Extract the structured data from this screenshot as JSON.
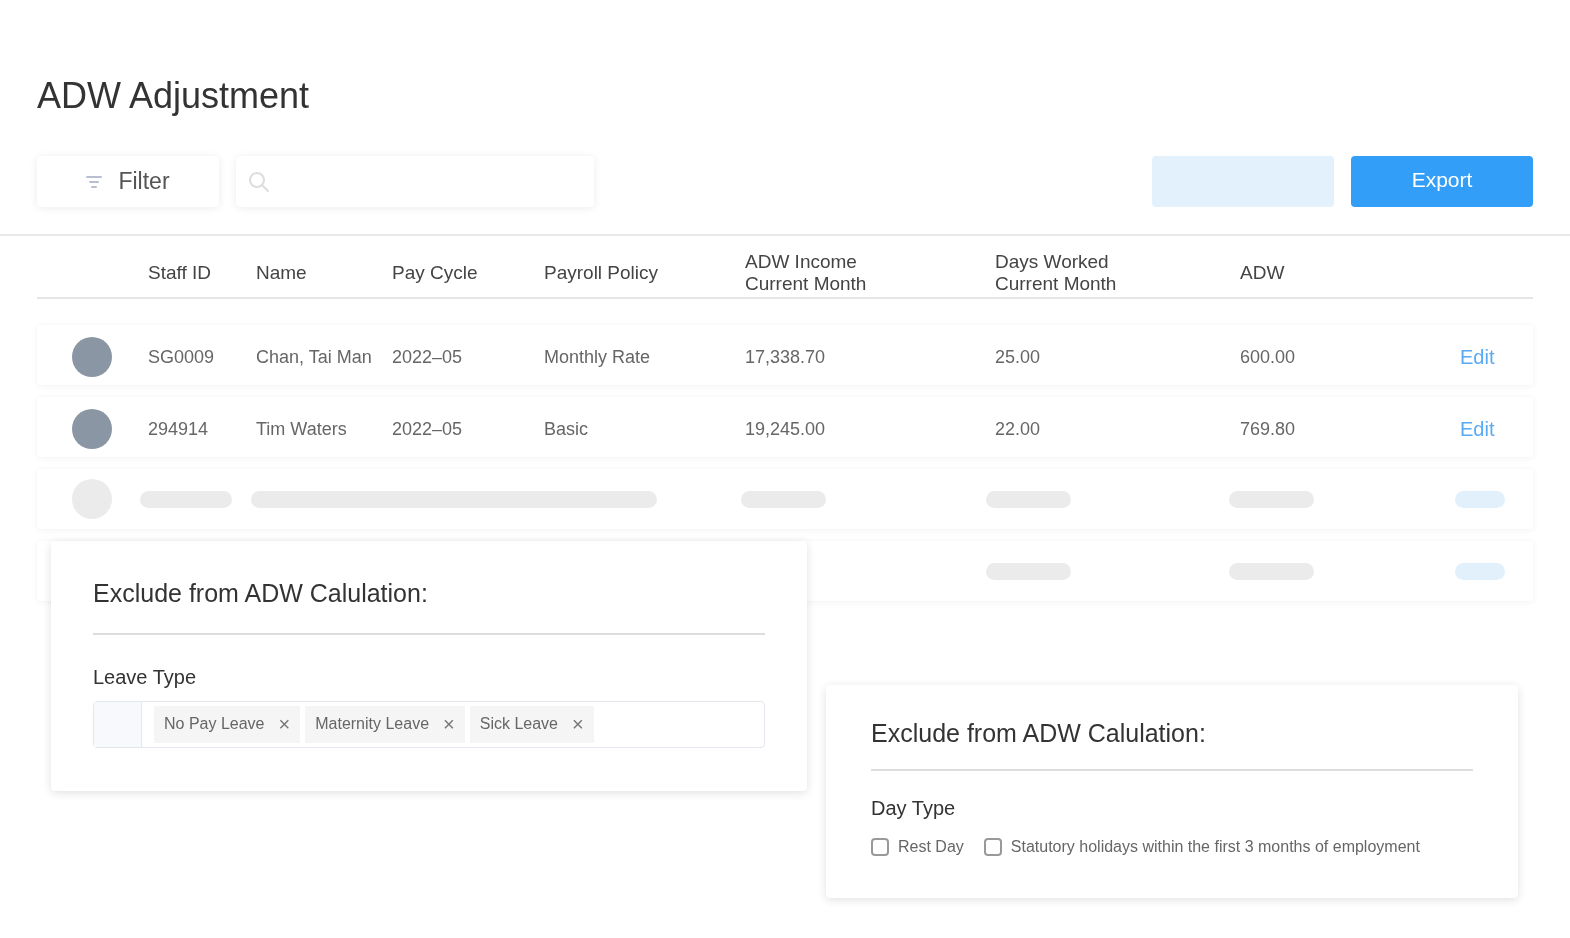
{
  "page": {
    "title": "ADW Adjustment"
  },
  "toolbar": {
    "filter_label": "Filter",
    "export_label": "Export"
  },
  "table": {
    "columns": [
      "Staff ID",
      "Name",
      "Pay Cycle",
      "Payroll Policy",
      "ADW Income\nCurrent Month",
      "Days Worked\nCurrent Month",
      "ADW"
    ],
    "rows": [
      {
        "staff_id": "SG0009",
        "name": "Chan, Tai Man",
        "pay_cycle": "2022–05",
        "payroll_policy": "Monthly Rate",
        "adw_income": "17,338.70",
        "days_worked": "25.00",
        "adw": "600.00",
        "action": "Edit"
      },
      {
        "staff_id": "294914",
        "name": "Tim Waters",
        "pay_cycle": "2022–05",
        "payroll_policy": "Basic",
        "adw_income": "19,245.00",
        "days_worked": "22.00",
        "adw": "769.80",
        "action": "Edit"
      }
    ]
  },
  "leave_panel": {
    "title": "Exclude from ADW Calulation:",
    "label": "Leave Type",
    "tags": [
      {
        "text": "No Pay Leave",
        "remove": "×"
      },
      {
        "text": "Maternity Leave",
        "remove": "×"
      },
      {
        "text": "Sick Leave",
        "remove": "×"
      }
    ]
  },
  "day_panel": {
    "title": "Exclude from ADW Calulation:",
    "label": "Day Type",
    "options": [
      {
        "label": "Rest Day",
        "checked": false
      },
      {
        "label": "Statutory holidays within the first 3 months of employment",
        "checked": false
      }
    ]
  }
}
